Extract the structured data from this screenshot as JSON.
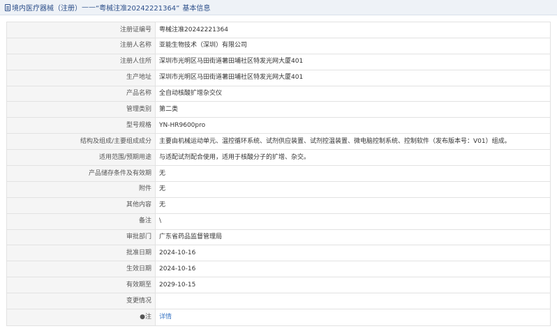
{
  "header": {
    "category": "境内医疗器械（注册）",
    "separator": "——",
    "record_title": "“粤械注准20242221364”",
    "suffix": "基本信息",
    "icon": "document-icon"
  },
  "rows": [
    {
      "label": "注册证编号",
      "value": "粤械注准20242221364"
    },
    {
      "label": "注册人名称",
      "value": "亚能生物技术（深圳）有限公司"
    },
    {
      "label": "注册人住所",
      "value": "深圳市光明区马田街道薯田埔社区特发光网大厦401"
    },
    {
      "label": "生产地址",
      "value": "深圳市光明区马田街道薯田埔社区特发光网大厦401"
    },
    {
      "label": "产品名称",
      "value": "全自动核酸扩增杂交仪"
    },
    {
      "label": "管理类别",
      "value": "第二类"
    },
    {
      "label": "型号规格",
      "value": "YN-HR9600pro"
    },
    {
      "label": "结构及组成/主要组成成分",
      "value": "主要由机械运动单元、温控循环系统、试剂供应装置、试剂控温装置、微电脑控制系统、控制软件（发布版本号：V01）组成。"
    },
    {
      "label": "适用范围/预期用途",
      "value": "与适配试剂配合使用，适用于核酸分子的扩增、杂交。"
    },
    {
      "label": "产品储存条件及有效期",
      "value": "无"
    },
    {
      "label": "附件",
      "value": "无"
    },
    {
      "label": "其他内容",
      "value": "无"
    },
    {
      "label": "备注",
      "value": "\\"
    },
    {
      "label": "审批部门",
      "value": "广东省药品监督管理局"
    },
    {
      "label": "批准日期",
      "value": "2024-10-16"
    },
    {
      "label": "生效日期",
      "value": "2024-10-16"
    },
    {
      "label": "有效期至",
      "value": "2029-10-15"
    },
    {
      "label": "变更情况",
      "value": ""
    }
  ],
  "note_row": {
    "label": "●注",
    "link_text": "详情"
  },
  "colors": {
    "title_text": "#2c4f8a",
    "link": "#3a76c4",
    "label_bg": "#f5f5f5",
    "border": "#e2e2e2"
  }
}
